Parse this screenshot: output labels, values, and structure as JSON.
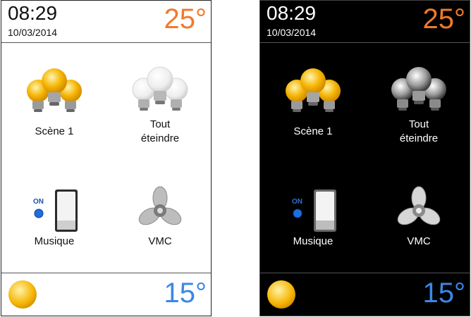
{
  "panels": [
    {
      "theme": "light",
      "header": {
        "time": "08:29",
        "date": "10/03/2014",
        "temperature": "25°"
      },
      "tiles": [
        {
          "label": "Scène 1",
          "icon": "bulbs-on-icon"
        },
        {
          "label": "Tout éteindre",
          "line1": "Tout",
          "line2": "éteindre",
          "icon": "bulbs-off-icon"
        },
        {
          "label": "Musique",
          "icon": "switch-on-icon",
          "switch_text": "ON"
        },
        {
          "label": "VMC",
          "icon": "fan-icon"
        }
      ],
      "footer": {
        "icon": "sun-icon",
        "temperature": "15°"
      }
    },
    {
      "theme": "dark",
      "header": {
        "time": "08:29",
        "date": "10/03/2014",
        "temperature": "25°"
      },
      "tiles": [
        {
          "label": "Scène 1",
          "icon": "bulbs-on-icon"
        },
        {
          "label": "Tout éteindre",
          "line1": "Tout",
          "line2": "éteindre",
          "icon": "bulbs-off-icon"
        },
        {
          "label": "Musique",
          "icon": "switch-on-icon",
          "switch_text": "ON"
        },
        {
          "label": "VMC",
          "icon": "fan-icon"
        }
      ],
      "footer": {
        "icon": "sun-icon",
        "temperature": "15°"
      }
    }
  ],
  "colors": {
    "indoor_temp": "#f07a2a",
    "outdoor_temp": "#3b87e6",
    "bulb_on": "#f5b400",
    "sun": "#f5b400",
    "led_on": "#1d6fe0"
  }
}
